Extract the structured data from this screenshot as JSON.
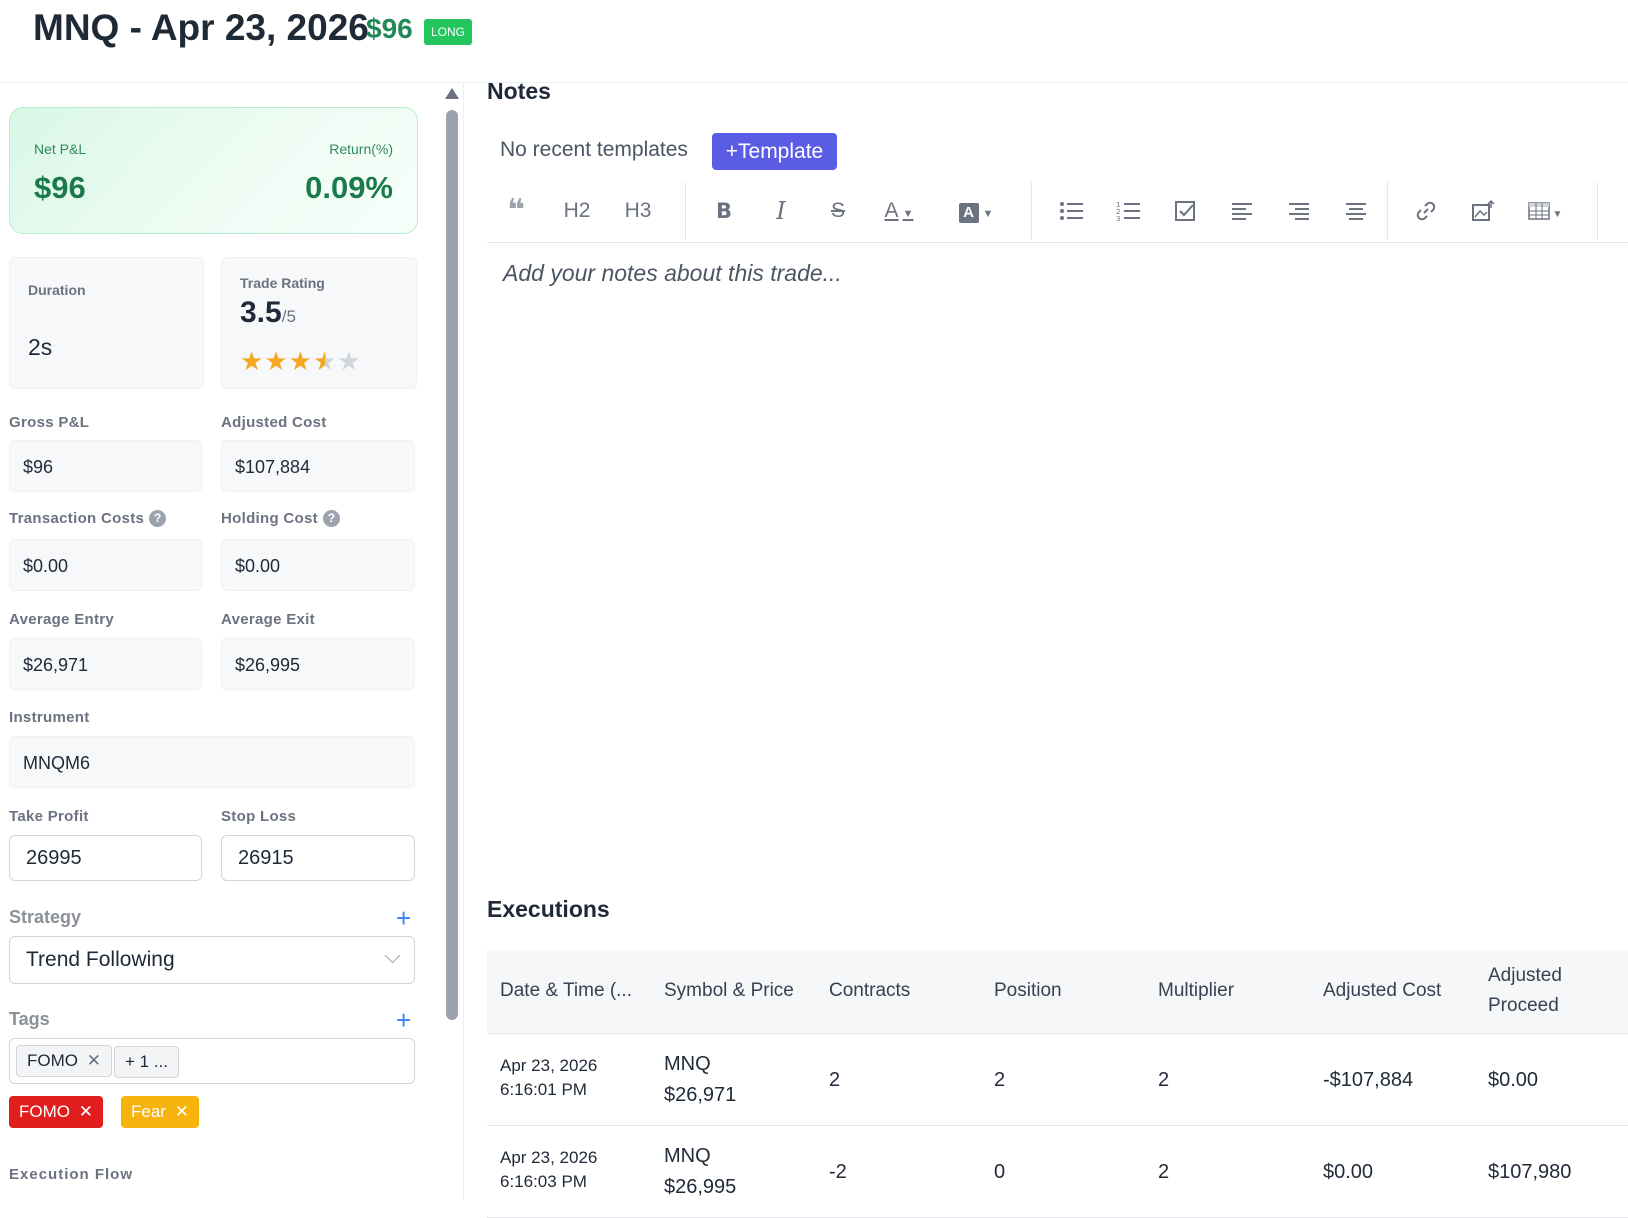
{
  "header": {
    "title": "MNQ - Apr 23, 2026",
    "pnl": "$96",
    "direction_badge": "LONG"
  },
  "summary": {
    "net_pnl_label": "Net P&L",
    "net_pnl_value": "$96",
    "return_label": "Return(%)",
    "return_value": "0.09%",
    "duration_label": "Duration",
    "duration_value": "2s",
    "rating_label": "Trade Rating",
    "rating_value": "3.5",
    "rating_max": "/5",
    "rating_stars": 3.5
  },
  "fields": {
    "gross_pnl_label": "Gross P&L",
    "gross_pnl": "$96",
    "adjusted_cost_label": "Adjusted Cost",
    "adjusted_cost": "$107,884",
    "transaction_costs_label": "Transaction Costs",
    "transaction_costs": "$0.00",
    "holding_cost_label": "Holding Cost",
    "holding_cost": "$0.00",
    "average_entry_label": "Average Entry",
    "average_entry": "$26,971",
    "average_exit_label": "Average Exit",
    "average_exit": "$26,995",
    "instrument_label": "Instrument",
    "instrument": "MNQM6",
    "take_profit_label": "Take Profit",
    "take_profit": "26995",
    "stop_loss_label": "Stop Loss",
    "stop_loss": "26915"
  },
  "strategy": {
    "label": "Strategy",
    "selected": "Trend Following"
  },
  "tags": {
    "label": "Tags",
    "selected_chip": "FOMO",
    "more_chip": "+ 1 ...",
    "pills": [
      {
        "label": "FOMO",
        "color": "#e11d1d"
      },
      {
        "label": "Fear",
        "color": "#f5b30b"
      }
    ]
  },
  "execution_flow_label": "Execution Flow",
  "notes": {
    "title": "Notes",
    "no_templates": "No recent templates",
    "template_button": "+Template",
    "placeholder": "Add your notes about this trade...",
    "toolbar": {
      "h2": "H2",
      "h3": "H3",
      "bold": "B",
      "italic": "I",
      "strike": "S",
      "font_color": "A",
      "highlight": "A"
    }
  },
  "executions": {
    "title": "Executions",
    "columns": [
      "Date & Time (...",
      "Symbol & Price",
      "Contracts",
      "Position",
      "Multiplier",
      "Adjusted Cost",
      "Adjusted Proceed"
    ],
    "rows": [
      {
        "date": "Apr 23, 2026",
        "time": "6:16:01 PM",
        "symbol": "MNQ",
        "price": "$26,971",
        "contracts": "2",
        "position": "2",
        "multiplier": "2",
        "adjusted_cost": "-$107,884",
        "adjusted_proceed": "$0.00"
      },
      {
        "date": "Apr 23, 2026",
        "time": "6:16:03 PM",
        "symbol": "MNQ",
        "price": "$26,995",
        "contracts": "-2",
        "position": "0",
        "multiplier": "2",
        "adjusted_cost": "$0.00",
        "adjusted_proceed": "$107,980"
      }
    ]
  },
  "colors": {
    "accent": "#5b5ce6",
    "profit": "#1a7a4a",
    "long_badge": "#22c55e",
    "link_plus": "#3b82f6"
  }
}
